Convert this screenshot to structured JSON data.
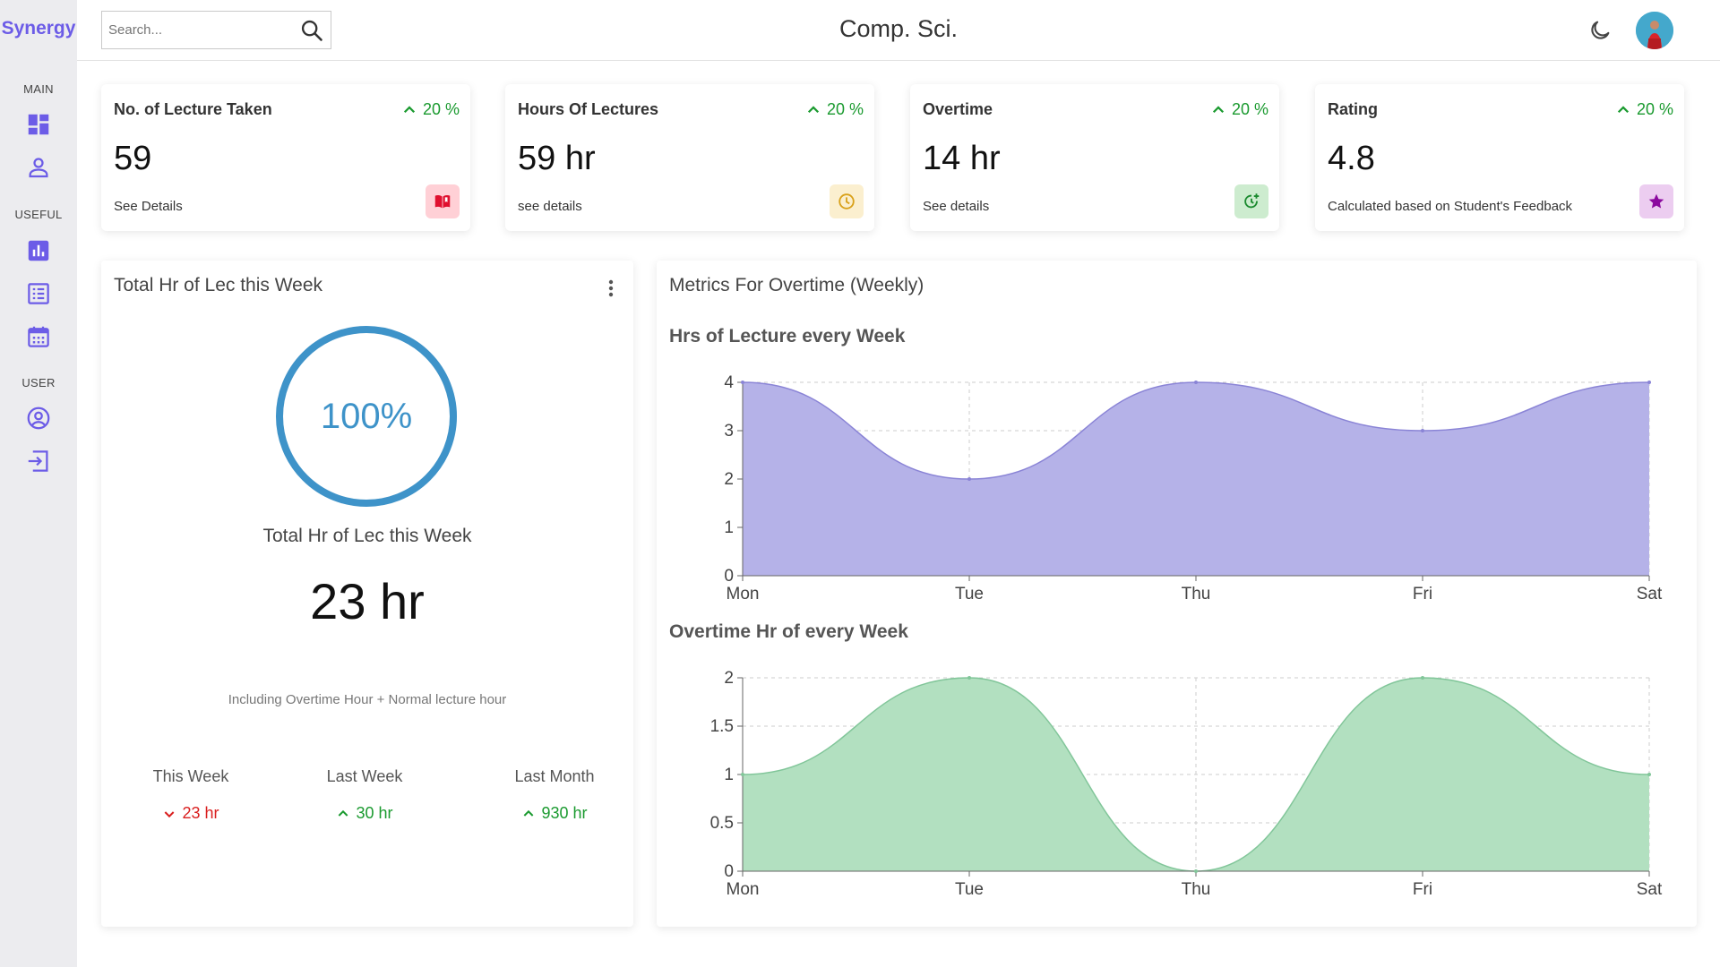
{
  "brand": "Synergy",
  "sidebar": {
    "sections": [
      {
        "label": "MAIN",
        "items": [
          {
            "icon": "dashboard-icon"
          },
          {
            "icon": "user-icon"
          }
        ]
      },
      {
        "label": "USEFUL",
        "items": [
          {
            "icon": "bar-chart-icon"
          },
          {
            "icon": "list-icon"
          },
          {
            "icon": "calendar-icon"
          }
        ]
      },
      {
        "label": "USER",
        "items": [
          {
            "icon": "account-circle-icon"
          },
          {
            "icon": "logout-icon"
          }
        ]
      }
    ],
    "accent": "#6c5ce7"
  },
  "header": {
    "search_placeholder": "Search...",
    "title": "Comp. Sci.",
    "theme_icon": "moon-icon",
    "avatar_icon": "avatar"
  },
  "stats": [
    {
      "title": "No. of Lecture Taken",
      "change": "20 %",
      "value": "59",
      "footer": "See Details",
      "icon": "book-icon",
      "icon_color": "#e0102f",
      "icon_bg": "#ffd0d6"
    },
    {
      "title": "Hours Of Lectures",
      "change": "20 %",
      "value": "59 hr",
      "footer": "see details",
      "icon": "clock-icon",
      "icon_color": "#d9a11a",
      "icon_bg": "#fbefcf"
    },
    {
      "title": "Overtime",
      "change": "20 %",
      "value": "14 hr",
      "footer": "See details",
      "icon": "timer-plus-icon",
      "icon_color": "#1a8a2e",
      "icon_bg": "#cdeccf"
    },
    {
      "title": "Rating",
      "change": "20 %",
      "value": "4.8",
      "footer": "Calculated based on Student's Feedback",
      "icon": "star-icon",
      "icon_color": "#8b0a9e",
      "icon_bg": "#eccdf0"
    }
  ],
  "weekly_panel": {
    "title": "Total Hr of Lec this Week",
    "progress_label": "100%",
    "progress_value": 1.0,
    "ring_label": "Total Hr of Lec this Week",
    "total": "23 hr",
    "note": "Including Overtime Hour + Normal lecture hour",
    "periods": [
      {
        "label": "This Week",
        "value": "23 hr",
        "trend": "down"
      },
      {
        "label": "Last Week",
        "value": "30 hr",
        "trend": "up"
      },
      {
        "label": "Last Month",
        "value": "930 hr",
        "trend": "up"
      }
    ]
  },
  "metrics_panel": {
    "title": "Metrics For Overtime (Weekly)"
  },
  "chart_data": [
    {
      "type": "area",
      "title": "Hrs of Lecture every Week",
      "categories": [
        "Mon",
        "Tue",
        "Thu",
        "Fri",
        "Sat"
      ],
      "values": [
        4,
        2,
        4,
        3,
        4
      ],
      "yticks": [
        "0",
        "1",
        "2",
        "3",
        "4"
      ],
      "ylim": [
        0,
        4
      ],
      "grid": true,
      "fill": "#b5b2e8",
      "stroke": "#8a84d6"
    },
    {
      "type": "area",
      "title": "Overtime Hr of every Week",
      "categories": [
        "Mon",
        "Tue",
        "Thu",
        "Fri",
        "Sat"
      ],
      "values": [
        1,
        2,
        0,
        2,
        1
      ],
      "yticks": [
        "0",
        "0.5",
        "1",
        "1.5",
        "2"
      ],
      "ylim": [
        0,
        2
      ],
      "grid": true,
      "fill": "#b2e0c0",
      "stroke": "#82c69a"
    }
  ]
}
